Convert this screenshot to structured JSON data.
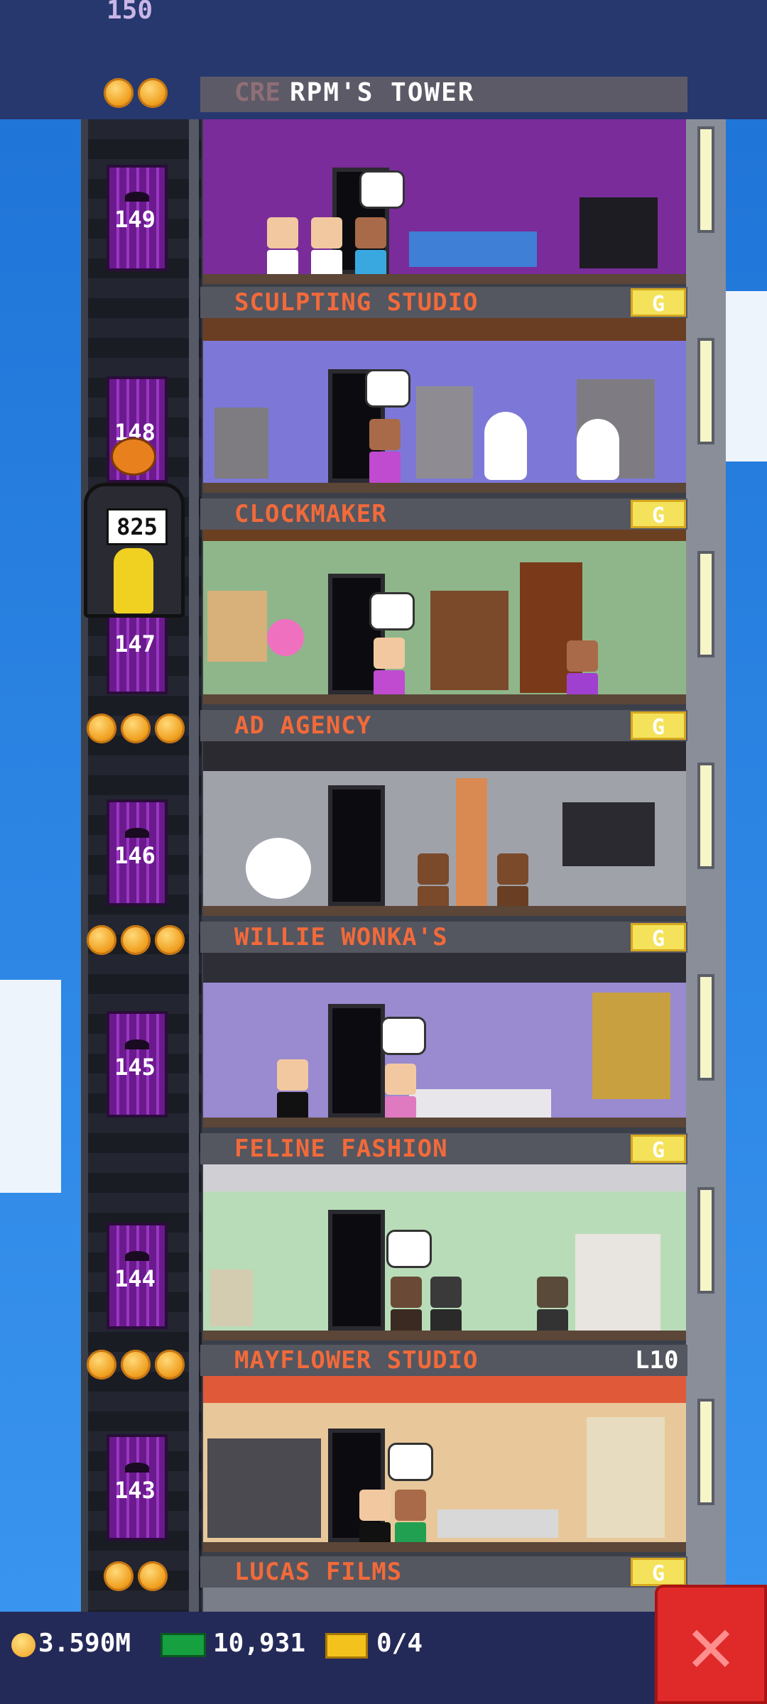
{
  "header": {
    "top_floor_number": "150",
    "tower_name": "RPM'S TOWER",
    "ghost_prefix": "CRE",
    "coin_count": 2
  },
  "floors": [
    {
      "number": "149",
      "room": "sculpting_studio_above",
      "name": "SCULPTING STUDIO",
      "badge": "G",
      "coins": 0
    },
    {
      "number": "148",
      "name": "CLOCKMAKER",
      "badge": "G",
      "coins": 0
    },
    {
      "number": "147",
      "name": "AD AGENCY",
      "badge": "G",
      "coins": 3
    },
    {
      "number": "146",
      "name": "WILLIE WONKA'S",
      "badge": "G",
      "coins": 3
    },
    {
      "number": "145",
      "name": "FELINE FASHION",
      "badge": "G",
      "coins": 0
    },
    {
      "number": "144",
      "name": "MAYFLOWER STUDIO",
      "badge": "L10",
      "coins": 3
    },
    {
      "number": "143",
      "name": "LUCAS FILMS",
      "badge": "G",
      "coins": 2
    }
  ],
  "elevator": {
    "passenger_count": "825"
  },
  "status_bar": {
    "coins": "3.590M",
    "bux": "10,931",
    "tickets": "0/4"
  },
  "colors": {
    "sky": "#2f8ae6",
    "label_text": "#f26a3a",
    "badge": "#f4e25a",
    "close_button": "#e02a2a",
    "elevator_door": "#8a2cb8"
  },
  "icons": {
    "close": "close-x-icon",
    "coin": "coin-icon",
    "bux": "bux-icon",
    "ticket": "golden-ticket-icon"
  }
}
